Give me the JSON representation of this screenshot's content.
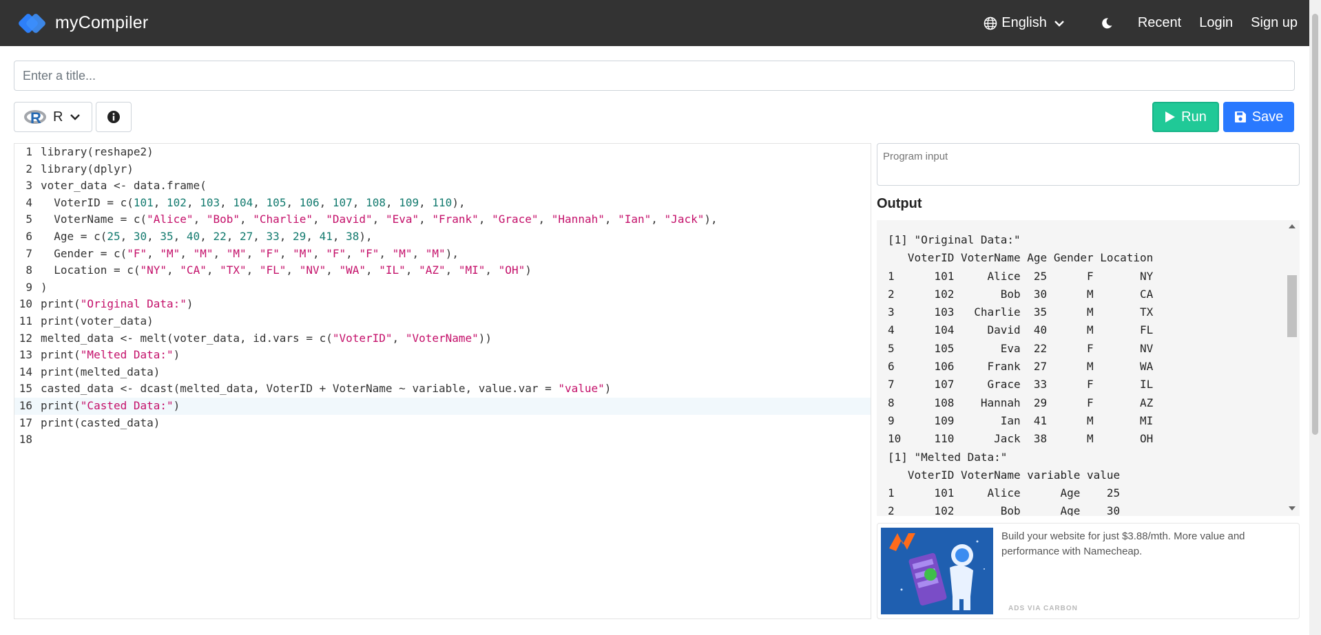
{
  "navbar": {
    "brand": "myCompiler",
    "language": "English",
    "links": [
      "Recent",
      "Login",
      "Sign up"
    ]
  },
  "title_input": {
    "placeholder": "Enter a title...",
    "value": ""
  },
  "toolbar": {
    "language": "R",
    "run_label": "Run",
    "save_label": "Save"
  },
  "editor": {
    "active_line": 16,
    "lines": [
      "library(reshape2)",
      "library(dplyr)",
      "voter_data <- data.frame(",
      "  VoterID = c(101, 102, 103, 104, 105, 106, 107, 108, 109, 110),",
      "  VoterName = c(\"Alice\", \"Bob\", \"Charlie\", \"David\", \"Eva\", \"Frank\", \"Grace\", \"Hannah\", \"Ian\", \"Jack\"),",
      "  Age = c(25, 30, 35, 40, 22, 27, 33, 29, 41, 38),",
      "  Gender = c(\"F\", \"M\", \"M\", \"M\", \"F\", \"M\", \"F\", \"F\", \"M\", \"M\"),",
      "  Location = c(\"NY\", \"CA\", \"TX\", \"FL\", \"NV\", \"WA\", \"IL\", \"AZ\", \"MI\", \"OH\")",
      ")",
      "print(\"Original Data:\")",
      "print(voter_data)",
      "melted_data <- melt(voter_data, id.vars = c(\"VoterID\", \"VoterName\"))",
      "print(\"Melted Data:\")",
      "print(melted_data)",
      "casted_data <- dcast(melted_data, VoterID + VoterName ~ variable, value.var = \"value\")",
      "print(\"Casted Data:\")",
      "print(casted_data)",
      ""
    ]
  },
  "program_input": {
    "placeholder": "Program input"
  },
  "output": {
    "heading": "Output",
    "lines": [
      "[1] \"Original Data:\"",
      "   VoterID VoterName Age Gender Location",
      "1      101     Alice  25      F       NY",
      "2      102       Bob  30      M       CA",
      "3      103   Charlie  35      M       TX",
      "4      104     David  40      M       FL",
      "5      105       Eva  22      F       NV",
      "6      106     Frank  27      M       WA",
      "7      107     Grace  33      F       IL",
      "8      108    Hannah  29      F       AZ",
      "9      109       Ian  41      M       MI",
      "10     110      Jack  38      M       OH",
      "[1] \"Melted Data:\"",
      "   VoterID VoterName variable value",
      "1      101     Alice      Age    25",
      "2      102       Bob      Age    30"
    ]
  },
  "ad": {
    "text": "Build your website for just $3.88/mth. More value and performance with Namecheap.",
    "footer": "ADS VIA CARBON"
  },
  "colors": {
    "navbar": "#333333",
    "run": "#20c997",
    "save": "#2979ff",
    "string": "#c4106a",
    "number": "#127a6e"
  }
}
